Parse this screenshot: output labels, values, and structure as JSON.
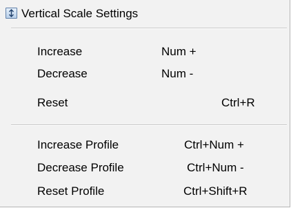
{
  "menu": {
    "header": {
      "label": "Vertical Scale Settings",
      "icon": "vertical-scale-icon"
    },
    "group1": [
      {
        "label": "Increase",
        "shortcut": "Num +"
      },
      {
        "label": "Decrease",
        "shortcut": "Num -"
      },
      {
        "label": "Reset",
        "shortcut": "Ctrl+R"
      }
    ],
    "group2": [
      {
        "label": "Increase Profile",
        "shortcut": "Ctrl+Num +"
      },
      {
        "label": "Decrease Profile",
        "shortcut": "Ctrl+Num -"
      },
      {
        "label": "Reset Profile",
        "shortcut": "Ctrl+Shift+R"
      }
    ]
  },
  "colors": {
    "background": "#f2f2f2",
    "separator": "#c8c8c8",
    "icon_border": "#5f7fa8"
  }
}
